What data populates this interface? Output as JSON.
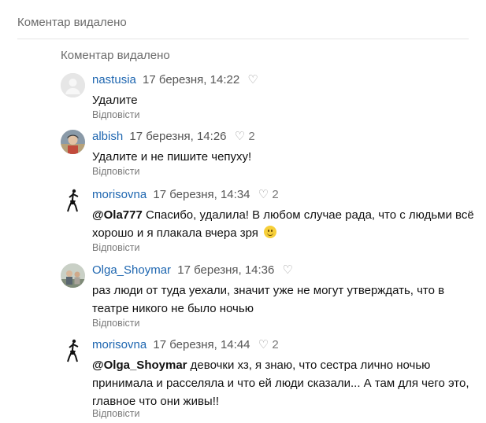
{
  "header": {
    "deleted_label": "Коментар видалено"
  },
  "thread": {
    "deleted_label": "Коментар видалено",
    "comments": [
      {
        "author": "nastusia",
        "time": "17 березня, 14:22",
        "likes": "",
        "text": "Удалите",
        "reply_label": "Відповісти"
      },
      {
        "author": "albish",
        "time": "17 березня, 14:26",
        "likes": "2",
        "text": "Удалите и не пишите чепуху!",
        "reply_label": "Відповісти"
      },
      {
        "author": "morisovna",
        "time": "17 березня, 14:34",
        "likes": "2",
        "mention": "@Ola777",
        "text": "Спасибо, удалила! В любом случае рада, что с людьми всё хорошо и я плакала вчера зря",
        "reply_label": "Відповісти"
      },
      {
        "author": "Olga_Shoymar",
        "time": "17 березня, 14:36",
        "likes": "",
        "text": "раз люди от туда уехали, значит уже не могут утверждать, что в театре никого не было ночью",
        "reply_label": "Відповісти"
      },
      {
        "author": "morisovna",
        "time": "17 березня, 14:44",
        "likes": "2",
        "mention": "@Olga_Shoymar",
        "text": "девочки хз, я знаю, что сестра лично ночью принимала и расселяла и что ей люди сказали... А там для чего это, главное что они живы!!",
        "reply_label": "Відповісти"
      }
    ]
  },
  "icons": {
    "like": "heart-outline-icon",
    "emoji": "slightly-smiling-face-icon"
  },
  "colors": {
    "author_link": "#1e66b0",
    "muted": "#7a7a7a"
  }
}
